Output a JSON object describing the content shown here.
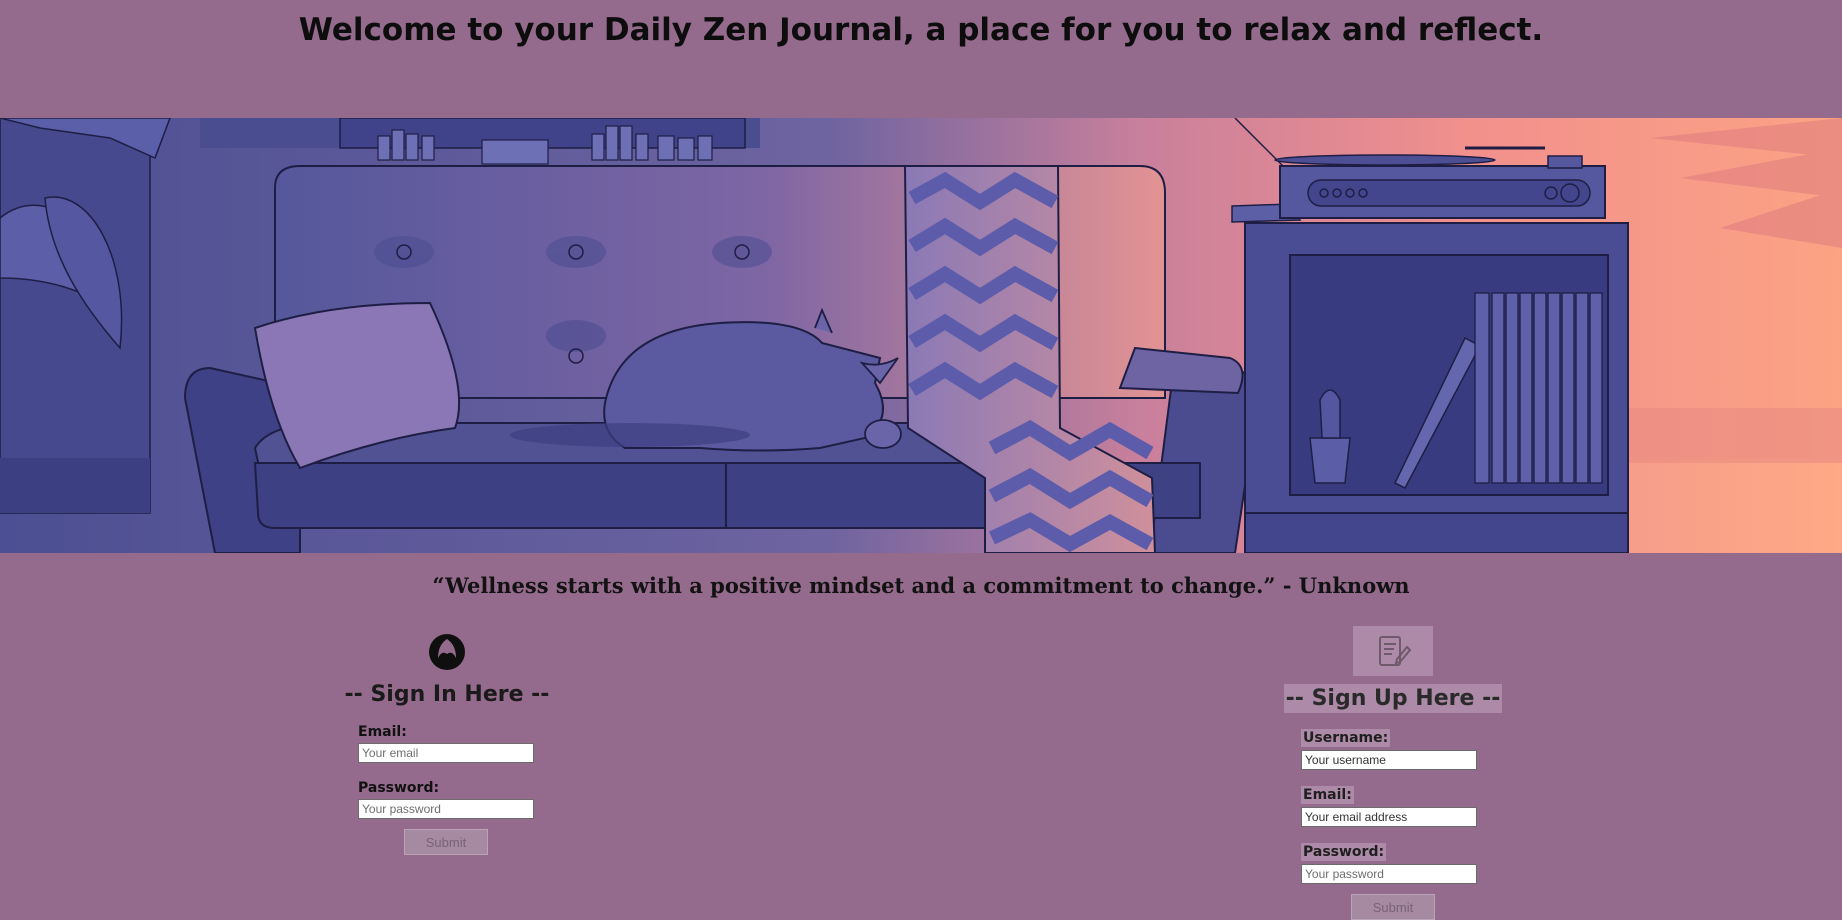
{
  "header": {
    "title": "Welcome to your Daily Zen Journal, a place for you to relax and reflect."
  },
  "quote": {
    "text": "“Wellness starts with a positive mindset and a commitment to change.” - Unknown"
  },
  "signin": {
    "icon": "lotus-flame-icon",
    "heading": "-- Sign In Here --",
    "email_label": "Email:",
    "email_placeholder": "Your email",
    "password_label": "Password:",
    "password_placeholder": "Your password",
    "submit_label": "Submit"
  },
  "signup": {
    "icon": "journal-pen-icon",
    "heading": "-- Sign Up Here --",
    "username_label": "Username:",
    "username_placeholder": "Your username",
    "email_label": "Email:",
    "email_placeholder": "Your email address",
    "password_label": "Password:",
    "password_placeholder": "Your password",
    "submit_label": "Submit"
  },
  "colors": {
    "page_background": "#946b8c",
    "scene_indigo": "#4f5196",
    "scene_sunset": "#f79a85"
  }
}
